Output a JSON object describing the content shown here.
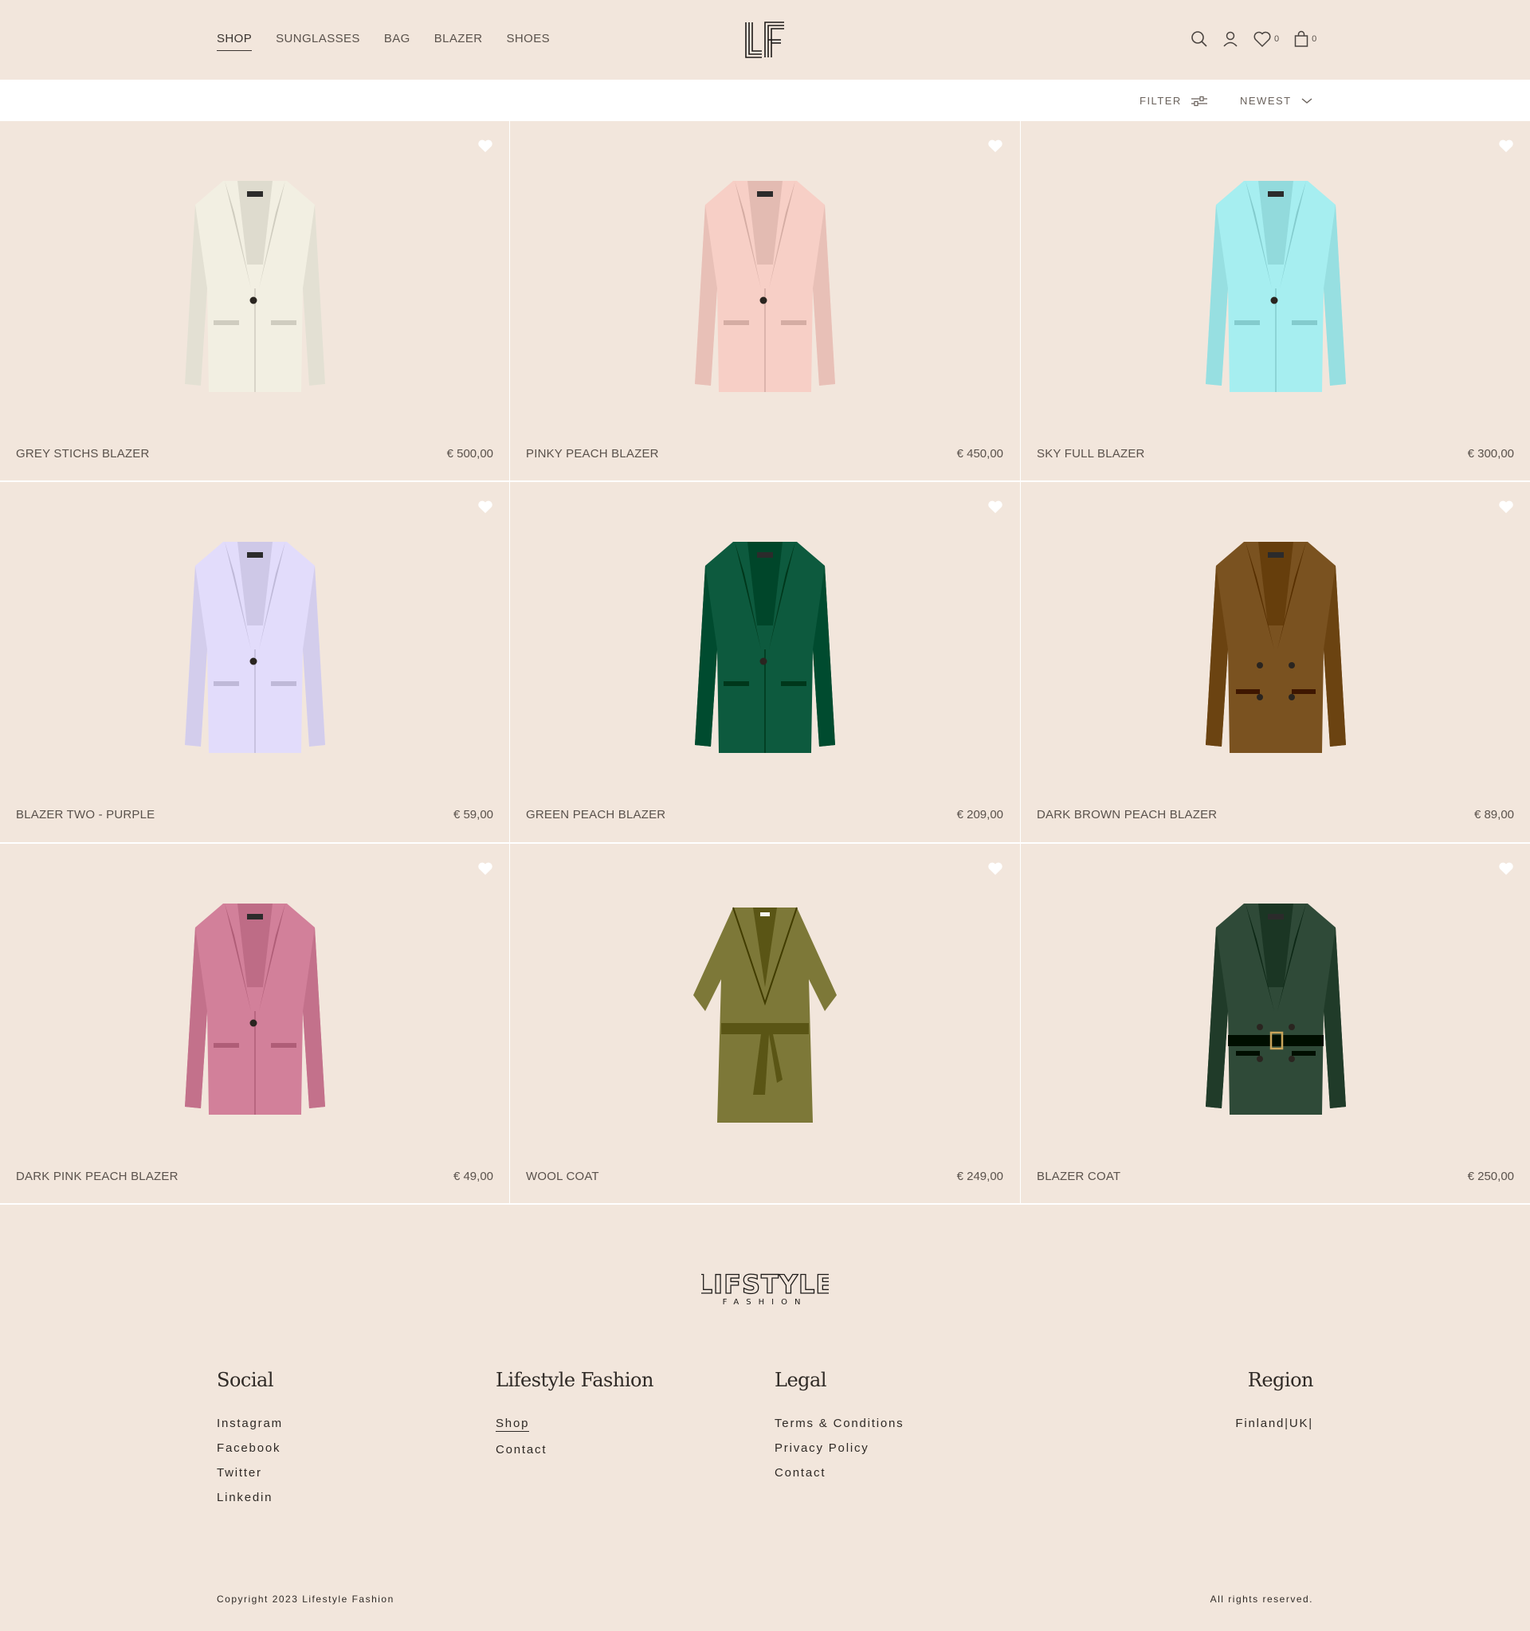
{
  "header": {
    "nav": [
      {
        "label": "SHOP",
        "active": true
      },
      {
        "label": "SUNGLASSES",
        "active": false
      },
      {
        "label": "BAG",
        "active": false
      },
      {
        "label": "BLAZER",
        "active": false
      },
      {
        "label": "SHOES",
        "active": false
      }
    ],
    "logo_icon": "lf-monogram-logo",
    "wishlist_count": "0",
    "cart_count": "0"
  },
  "toolbar": {
    "filter_label": "FILTER",
    "sort_label": "NEWEST"
  },
  "products": [
    {
      "name": "GREY STICHS BLAZER",
      "price": "€ 500,00",
      "color": "#f2efe2",
      "style": "single"
    },
    {
      "name": "PINKY PEACH BLAZER",
      "price": "€ 450,00",
      "color": "#f7cfc6",
      "style": "single"
    },
    {
      "name": "SKY FULL BLAZER",
      "price": "€ 300,00",
      "color": "#a6eef0",
      "style": "single"
    },
    {
      "name": "BLAZER TWO - PURPLE",
      "price": "€ 59,00",
      "color": "#e2dcfb",
      "style": "single"
    },
    {
      "name": "GREEN PEACH BLAZER",
      "price": "€ 209,00",
      "color": "#0d5a3e",
      "style": "single"
    },
    {
      "name": "DARK BROWN PEACH BLAZER",
      "price": "€ 89,00",
      "color": "#7a5220",
      "style": "double"
    },
    {
      "name": "DARK PINK PEACH BLAZER",
      "price": "€ 49,00",
      "color": "#d2809a",
      "style": "single"
    },
    {
      "name": "WOOL COAT",
      "price": "€ 249,00",
      "color": "#7d7838",
      "style": "coat"
    },
    {
      "name": "BLAZER COAT",
      "price": "€ 250,00",
      "color": "#2f4a38",
      "style": "belted"
    }
  ],
  "footer": {
    "brand_logo": "LIFSTYLE FASHION",
    "social": {
      "title": "Social",
      "links": [
        "Instagram",
        "Facebook",
        "Twitter",
        "Linkedin"
      ]
    },
    "company": {
      "title": "Lifestyle Fashion",
      "links": [
        "Shop",
        "Contact"
      ]
    },
    "legal": {
      "title": "Legal",
      "links": [
        "Terms & Conditions",
        "Privacy Policy",
        "Contact"
      ]
    },
    "region": {
      "title": "Region",
      "value": "Finland|UK|"
    },
    "copyright": "Copyright 2023 Lifestyle Fashion",
    "rights": "All rights reserved."
  }
}
